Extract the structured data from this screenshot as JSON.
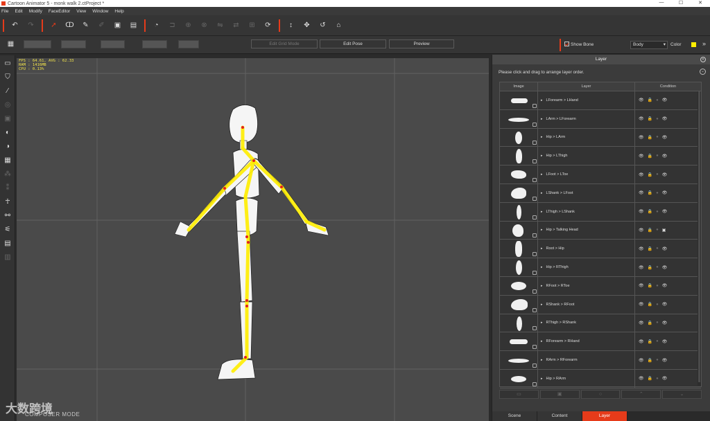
{
  "titlebar": {
    "title": "Cartoon Animator 5 - monk walk 2.ctProject *",
    "min": "—",
    "max": "☐",
    "close": "✕"
  },
  "menu": [
    "File",
    "Edit",
    "Modify",
    "FaceEditor",
    "View",
    "Window",
    "Help"
  ],
  "toolbar": {
    "edit_grid_mode": "Edit Grid Mode",
    "edit_pose": "Edit Pose",
    "preview": "Preview",
    "show_bone": "Show Bone",
    "body_select": "Body",
    "color_label": "Color",
    "bone_color": "#ffee00"
  },
  "stats": "FPS : 64.61, AVG : 62.33\nRAM : 1416MB\nCPU : 0.13%",
  "watermark": {
    "logo": "大数跨境",
    "mode": "COMPOSER MODE"
  },
  "panel": {
    "title": "Layer",
    "hint": "Please click and drag to arrange layer order.",
    "columns": [
      "Image",
      "Layer",
      "Condition"
    ],
    "rows": [
      {
        "layer": "LForearm > LHand",
        "dim_third": false,
        "alt_last": false
      },
      {
        "layer": "LArm > LForearm",
        "dim_third": false,
        "alt_last": false
      },
      {
        "layer": "Hip > LArm",
        "dim_third": false,
        "alt_last": false
      },
      {
        "layer": "Hip > LThigh",
        "dim_third": false,
        "alt_last": false
      },
      {
        "layer": "LFoot > LToe",
        "dim_third": false,
        "alt_last": false
      },
      {
        "layer": "LShank > LFoot",
        "dim_third": false,
        "alt_last": false
      },
      {
        "layer": "LThigh > LShank",
        "dim_third": false,
        "alt_last": false
      },
      {
        "layer": "Hip > Talking Head",
        "dim_third": false,
        "alt_last": true
      },
      {
        "layer": "Root > Hip",
        "dim_third": false,
        "alt_last": false
      },
      {
        "layer": "Hip > RThigh",
        "dim_third": false,
        "alt_last": false
      },
      {
        "layer": "RFoot > RToe",
        "dim_third": false,
        "alt_last": false
      },
      {
        "layer": "RShank > RFoot",
        "dim_third": false,
        "alt_last": false
      },
      {
        "layer": "RThigh > RShank",
        "dim_third": false,
        "alt_last": false
      },
      {
        "layer": "RForearm > RHand",
        "dim_third": false,
        "alt_last": false
      },
      {
        "layer": "RArm > RForearm",
        "dim_third": false,
        "alt_last": false
      },
      {
        "layer": "Hip > RArm",
        "dim_third": false,
        "alt_last": false
      }
    ],
    "tabs": [
      "Scene",
      "Content",
      "Layer"
    ],
    "active_tab": "Layer"
  }
}
